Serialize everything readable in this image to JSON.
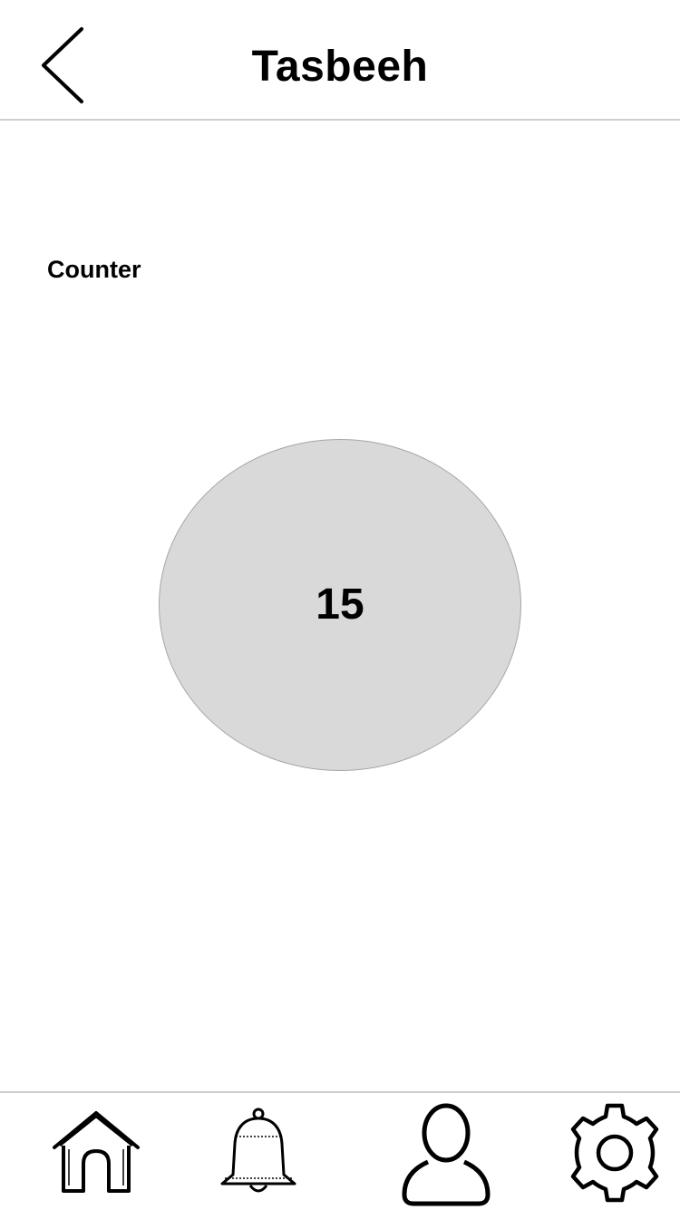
{
  "header": {
    "title": "Tasbeeh",
    "back_icon": "chevron-left-icon"
  },
  "counter": {
    "label": "Counter",
    "value": "15",
    "circle_color": "#d9d9d9"
  },
  "bottom_nav": {
    "items": [
      {
        "id": "home",
        "icon": "home-icon"
      },
      {
        "id": "notifications",
        "icon": "bell-icon"
      },
      {
        "id": "profile",
        "icon": "user-icon"
      },
      {
        "id": "settings",
        "icon": "gear-icon"
      }
    ]
  }
}
